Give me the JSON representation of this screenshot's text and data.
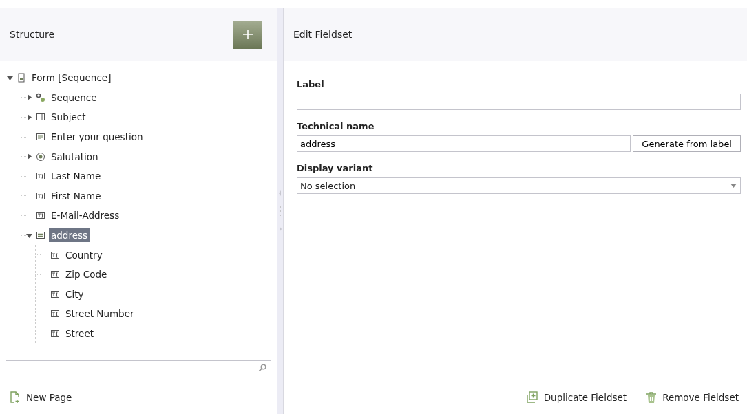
{
  "structure": {
    "title": "Structure",
    "tree": [
      {
        "label": "Form [Sequence]",
        "kind": "form",
        "expanded": true,
        "selected": false,
        "children": [
          {
            "label": "Sequence",
            "kind": "sequence",
            "expanded": false,
            "selected": false
          },
          {
            "label": "Subject",
            "kind": "table",
            "expanded": false,
            "selected": false
          },
          {
            "label": "Enter your question",
            "kind": "textarea",
            "selected": false
          },
          {
            "label": "Salutation",
            "kind": "radio",
            "expanded": false,
            "selected": false
          },
          {
            "label": "Last Name",
            "kind": "textfield",
            "selected": false
          },
          {
            "label": "First Name",
            "kind": "textfield",
            "selected": false
          },
          {
            "label": "E-Mail-Address",
            "kind": "textfield",
            "selected": false
          },
          {
            "label": "address",
            "kind": "fieldset",
            "expanded": true,
            "selected": true,
            "children": [
              {
                "label": "Country",
                "kind": "textfield",
                "selected": false
              },
              {
                "label": "Zip Code",
                "kind": "textfield",
                "selected": false
              },
              {
                "label": "City",
                "kind": "textfield",
                "selected": false
              },
              {
                "label": "Street Number",
                "kind": "textfield",
                "selected": false
              },
              {
                "label": "Street",
                "kind": "textfield",
                "selected": false
              }
            ]
          }
        ]
      }
    ],
    "footer_action": "New Page"
  },
  "editor": {
    "title": "Edit Fieldset",
    "label_field": {
      "label": "Label"
    },
    "technical_name": {
      "label": "Technical name",
      "value": "address",
      "button": "Generate from label"
    },
    "display_variant": {
      "label": "Display variant",
      "value": "No selection"
    },
    "actions": [
      {
        "label": "Duplicate Fieldset",
        "kind": "duplicate"
      },
      {
        "label": "Remove Fieldset",
        "kind": "remove"
      }
    ]
  }
}
